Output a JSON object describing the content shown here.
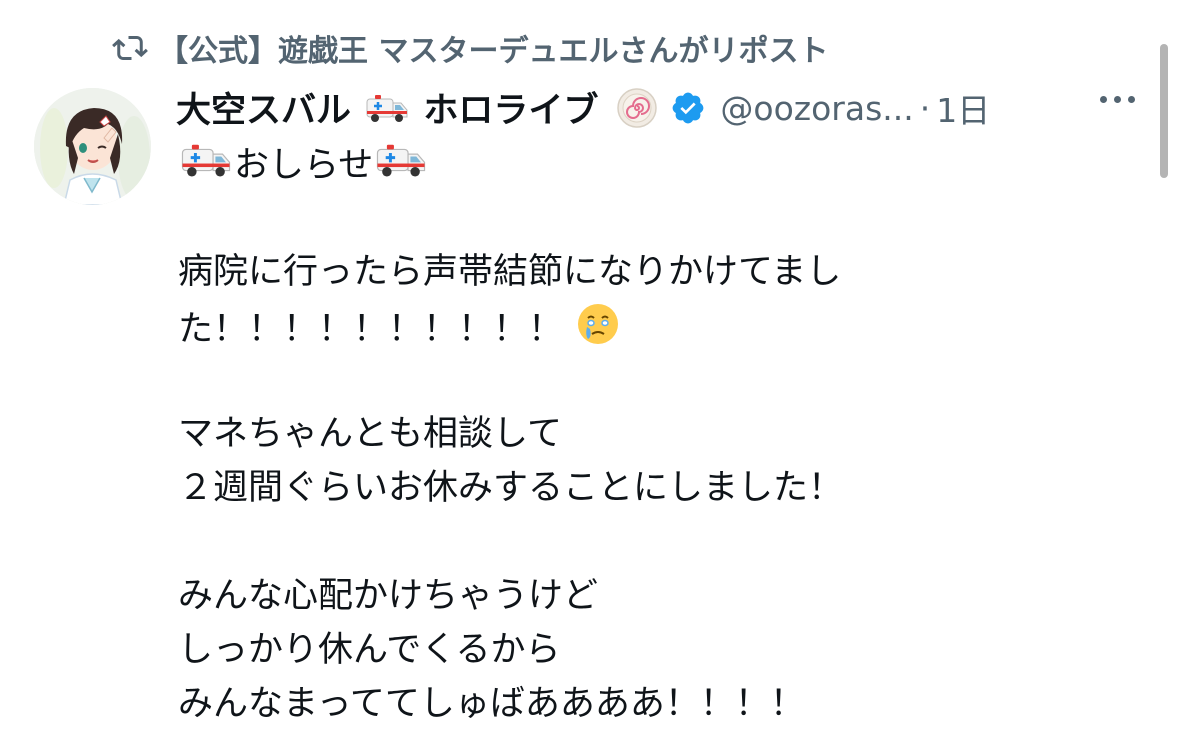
{
  "repost": {
    "text": "【公式】遊戯王 マスターデュエルさんがリポスト",
    "icon": "repost-icon"
  },
  "author": {
    "name_part1": "大空スバル",
    "name_part2": "ホロライブ",
    "handle": "@oozoras...",
    "separator": "·",
    "time": "1日",
    "emoji_icon": "ambulance-emoji",
    "badges": [
      "naruto-icon",
      "verified-badge-icon"
    ]
  },
  "tweet": {
    "line1": "おしらせ",
    "line2": "病院に行ったら声帯結節になりかけてまし",
    "line3": "た！！！！！！！！！！",
    "line4": "マネちゃんとも相談して",
    "line5": "２週間ぐらいお休みすることにしました！",
    "line6": "みんな心配かけちゃうけど",
    "line7": "しっかり休んでくるから",
    "line8": "みんなまっててしゅばああああ！！！！",
    "emoji_crying": "holding-back-tears-emoji"
  },
  "colors": {
    "text": "#0f1419",
    "secondary": "#536471",
    "verified": "#1d9bf0"
  }
}
